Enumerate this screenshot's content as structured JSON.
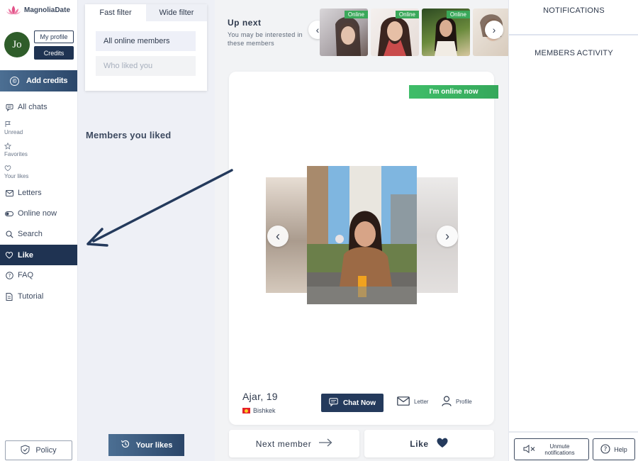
{
  "brand": {
    "name": "MagnoliaDate"
  },
  "user": {
    "initials": "Jo",
    "my_profile_label": "My profile",
    "credits_label": "Credits"
  },
  "sidebar": {
    "add_credits_label": "Add credits",
    "items": [
      {
        "label": "All chats",
        "icon": "chat-icon"
      },
      {
        "label": "Unread",
        "icon": "flag-icon"
      },
      {
        "label": "Favorites",
        "icon": "star-icon"
      },
      {
        "label": "Your likes",
        "icon": "heart-icon"
      },
      {
        "label": "Letters",
        "icon": "envelope-icon"
      },
      {
        "label": "Online now",
        "icon": "toggle-icon"
      },
      {
        "label": "Search",
        "icon": "search-icon"
      },
      {
        "label": "Like",
        "icon": "heart-icon",
        "active": true
      },
      {
        "label": "FAQ",
        "icon": "question-icon"
      },
      {
        "label": "Tutorial",
        "icon": "info-icon"
      }
    ],
    "policy_label": "Policy"
  },
  "filter": {
    "tabs": [
      "Fast filter",
      "Wide filter"
    ],
    "active_tab": "Fast filter",
    "options": [
      "All online members",
      "Who liked you"
    ],
    "selected_option": "All online members"
  },
  "members_liked_heading": "Members you liked",
  "your_likes_button": "Your likes",
  "up_next": {
    "title": "Up next",
    "subtitle": "You may be interested in these members",
    "thumbs": [
      {
        "badge": "Online"
      },
      {
        "badge": "Online"
      },
      {
        "badge": "Online"
      },
      {
        "badge": ""
      }
    ]
  },
  "profile_card": {
    "online_badge": "I'm online now",
    "name_age": "Ajar, 19",
    "city": "Bishkek",
    "chat_now_label": "Chat Now",
    "letter_label": "Letter",
    "profile_label": "Profile"
  },
  "actions": {
    "next_label": "Next member",
    "like_label": "Like"
  },
  "right_panel": {
    "notifications_heading": "NOTIFICATIONS",
    "activity_heading": "MEMBERS ACTIVITY",
    "unmute_label": "Unmute notifications",
    "help_label": "Help"
  },
  "colors": {
    "navy": "#1f3352",
    "online_green": "#3aa85a",
    "flag_red": "#e5202a"
  }
}
